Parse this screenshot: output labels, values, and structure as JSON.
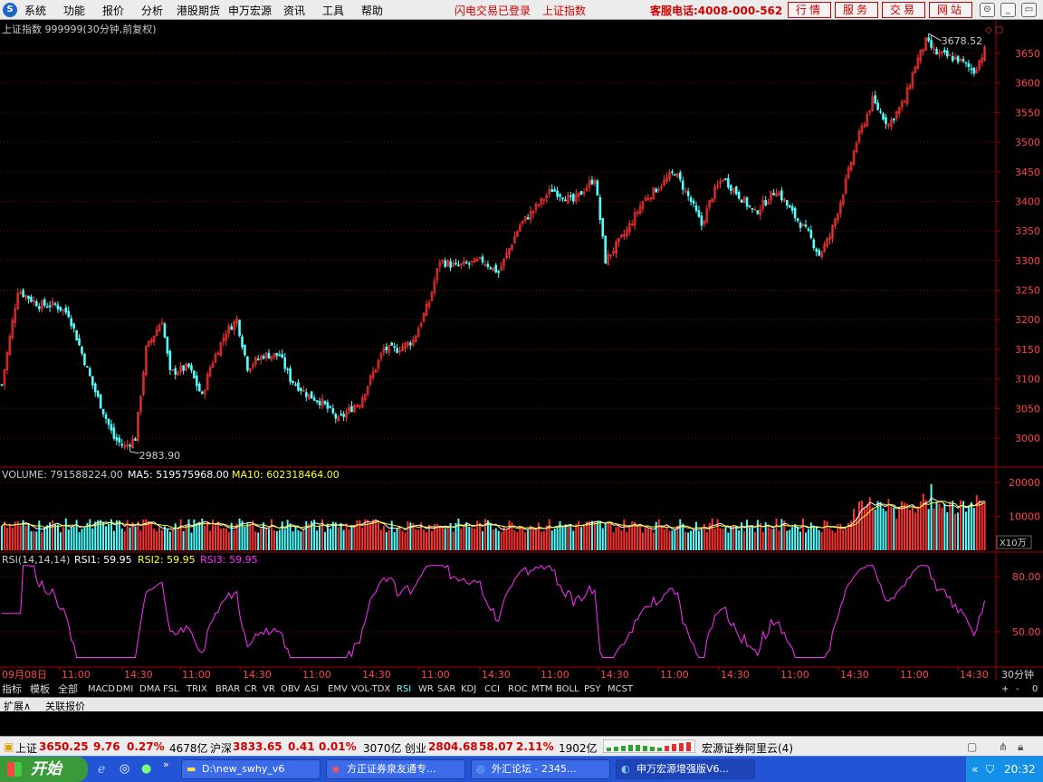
{
  "menu": {
    "items": [
      "系统",
      "功能",
      "报价",
      "分析",
      "港股期货",
      "申万宏源",
      "资讯",
      "工具",
      "帮助"
    ],
    "login_status": "闪电交易已登录",
    "index_link": "上证指数",
    "hotline": "客服电话:4008-000-562",
    "header_buttons": [
      "行情",
      "服务",
      "交易",
      "网站"
    ]
  },
  "main_chart": {
    "title": "上证指数 999999(30分钟,前复权)",
    "high_label": "3678.52",
    "low_label": "2983.90",
    "y_ticks": [
      "3650",
      "3600",
      "3550",
      "3500",
      "3450",
      "3400",
      "3350",
      "3300",
      "3250",
      "3200",
      "3150",
      "3100",
      "3050",
      "3000"
    ]
  },
  "volume_panel": {
    "label_volume": "VOLUME: 791588224.00",
    "label_ma5": "MA5: 519575968.00",
    "label_ma10": "MA10: 602318464.00",
    "y_ticks": [
      "20000",
      "10000"
    ],
    "unit": "X10万"
  },
  "rsi_panel": {
    "label_params": "RSI(14,14,14)",
    "label_rsi1": "RSI1: 59.95",
    "label_rsi2": "RSI2: 59.95",
    "label_rsi3": "RSI3: 59.95",
    "y_ticks": [
      "80.00",
      "50.00"
    ]
  },
  "x_axis": {
    "labels": [
      "09月08日",
      "11:00",
      "14:30",
      "11:00",
      "14:30",
      "11:00",
      "14:30",
      "11:00",
      "14:30",
      "11:00",
      "14:30",
      "11:00",
      "14:30",
      "11:00",
      "14:30",
      "11:00",
      "14:30"
    ],
    "period": "30分钟"
  },
  "indicator_tabs": [
    "指标",
    "模板",
    "全部",
    "MACD",
    "DMI",
    "DMA",
    "FSL",
    "TRIX",
    "BRAR",
    "CR",
    "VR",
    "OBV",
    "ASI",
    "EMV",
    "VOL-TDX",
    "RSI",
    "WR",
    "SAR",
    "KDJ",
    "CCI",
    "ROC",
    "MTM",
    "BOLL",
    "PSY",
    "MCST"
  ],
  "active_tab": "RSI",
  "right_controls": [
    "+",
    "-",
    "0"
  ],
  "sub_tabs": [
    "扩展∧",
    "关联报价"
  ],
  "status": {
    "sh_name": "上证",
    "sh_value": "3650.25",
    "sh_change": "9.76",
    "sh_pct": "0.27%",
    "sh_amount": "4678亿",
    "hs_name": "沪深",
    "hs_value": "3833.65",
    "hs_change": "0.41",
    "hs_pct": "0.01%",
    "hs_amount": "3070亿",
    "cy_name": "创业",
    "cy_value": "2804.68",
    "cy_change": "58.07",
    "cy_pct": "2.11%",
    "cy_amount": "1902亿",
    "server": "宏源证券阿里云(4)"
  },
  "taskbar": {
    "start": "开始",
    "tasks": [
      "D:\\new_swhy_v6",
      "方正证券泉友通专...",
      "外汇论坛 - 2345...",
      "申万宏源增强版V6..."
    ],
    "clock": "20:32"
  },
  "colors": {
    "up": "#ff3333",
    "down": "#54ffff",
    "rsi": "#ff30ff",
    "ma5": "#ffffff",
    "ma10": "#ffff30",
    "grid": "#8b0000"
  }
}
